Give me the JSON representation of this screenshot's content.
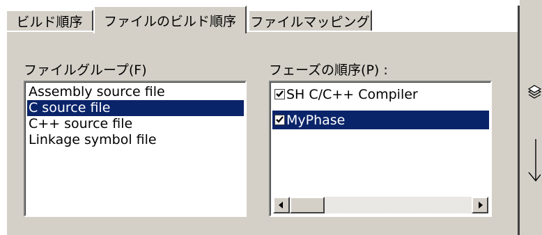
{
  "tabs": [
    {
      "label": "ビルド順序"
    },
    {
      "label": "ファイルのビルド順序"
    },
    {
      "label": "ファイルマッピング"
    }
  ],
  "file_group": {
    "label": "ファイルグループ(F)",
    "items": [
      {
        "label": "Assembly source file"
      },
      {
        "label": "C source file",
        "selected": true
      },
      {
        "label": "C++ source file"
      },
      {
        "label": "Linkage symbol file"
      }
    ]
  },
  "phase_order": {
    "label": "フェーズの順序(P) :",
    "items": [
      {
        "label": "SH C/C++ Compiler",
        "checked": true
      },
      {
        "label": "MyPhase",
        "checked": true,
        "selected": true
      }
    ]
  },
  "colors": {
    "selection": "#0a246a",
    "face": "#d4d0c8"
  },
  "icons": {
    "move_button": "stack-icon",
    "move_arrow": "down-arrow-icon"
  }
}
